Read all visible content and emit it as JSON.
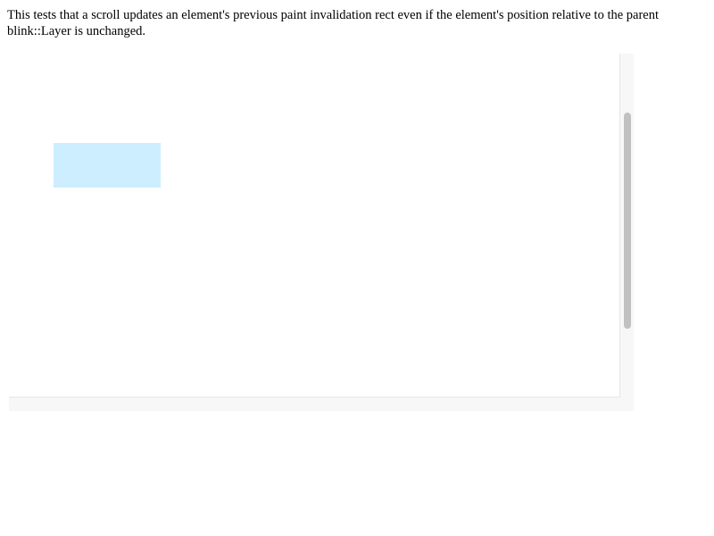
{
  "description": "This tests that a scroll updates an element's previous paint invalidation rect even if the element's position relative to the parent blink::Layer is unchanged.",
  "colors": {
    "box": "#cdeeff",
    "scrollbar_track": "#f7f7f7",
    "scrollbar_thumb": "#c1c1c1"
  },
  "scroll": {
    "vertical_position_fraction": 0.17,
    "vertical_visible_fraction": 0.63
  }
}
